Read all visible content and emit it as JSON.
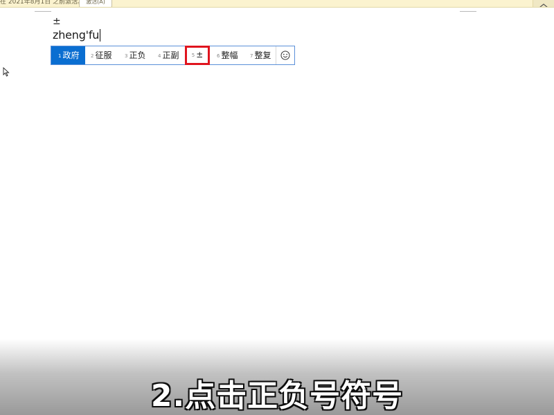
{
  "notification_bar": {
    "text": "在 2021年8月1日 之前激活。",
    "button_label": "激活(A)"
  },
  "document": {
    "line1": "±",
    "line2": "zheng'fu"
  },
  "ime": {
    "candidates": [
      {
        "num": "1",
        "text": "政府",
        "state": "selected"
      },
      {
        "num": "2",
        "text": "征服",
        "state": "normal"
      },
      {
        "num": "3",
        "text": "正负",
        "state": "normal"
      },
      {
        "num": "4",
        "text": "正副",
        "state": "normal"
      },
      {
        "num": "5",
        "text": "±",
        "state": "highlighted"
      },
      {
        "num": "6",
        "text": "整幅",
        "state": "normal"
      },
      {
        "num": "7",
        "text": "整复",
        "state": "normal"
      }
    ],
    "emoji_icon": "smiley-icon",
    "colors": {
      "selected_bg": "#0a6ed1",
      "highlight_border": "#e0141e",
      "bar_border": "#5a8fd8"
    }
  },
  "caption": {
    "text": "2.点击正负号符号"
  }
}
